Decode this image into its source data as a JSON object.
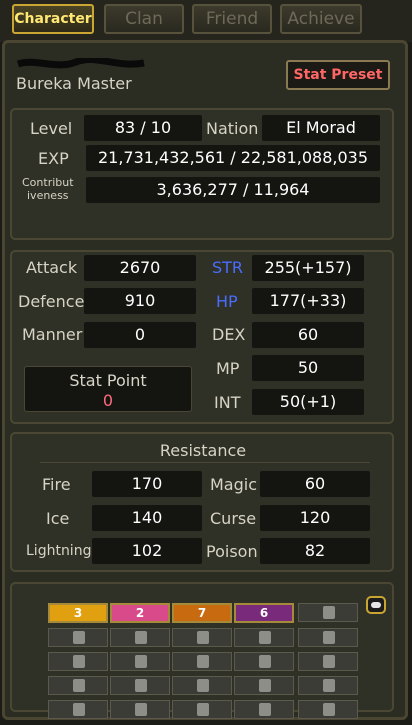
{
  "tabs": [
    {
      "label": "Character",
      "active": true
    },
    {
      "label": "Clan",
      "active": false
    },
    {
      "label": "Friend",
      "active": false
    },
    {
      "label": "Achieve",
      "active": false
    }
  ],
  "character": {
    "class_title": "Bureka Master"
  },
  "stat_preset_label": "Stat Preset",
  "info": {
    "level_label": "Level",
    "level_value": "83 / 10",
    "nation_label": "Nation",
    "nation_value": "El Morad",
    "exp_label": "EXP",
    "exp_value": "21,731,432,561 / 22,581,088,035",
    "contrib_label_1": "Contribut",
    "contrib_label_2": "iveness",
    "contrib_value": "3,636,277 / 11,964"
  },
  "stats": {
    "attack_label": "Attack",
    "attack_value": "2670",
    "defence_label": "Defence",
    "defence_value": "910",
    "manner_label": "Manner",
    "manner_value": "0",
    "str_label": "STR",
    "str_value": "255(+157)",
    "hp_label": "HP",
    "hp_value": "177(+33)",
    "dex_label": "DEX",
    "dex_value": "60",
    "mp_label": "MP",
    "mp_value": "50",
    "int_label": "INT",
    "int_value": "50(+1)",
    "stat_point_label": "Stat Point",
    "stat_point_value": "0"
  },
  "resistance": {
    "title": "Resistance",
    "fire_label": "Fire",
    "fire_value": "170",
    "magic_label": "Magic",
    "magic_value": "60",
    "ice_label": "Ice",
    "ice_value": "140",
    "curse_label": "Curse",
    "curse_value": "120",
    "lightning_label": "Lightning",
    "lightning_value": "102",
    "poison_label": "Poison",
    "poison_value": "82"
  },
  "badges": [
    {
      "text": "3",
      "color": "#e0a010"
    },
    {
      "text": "2",
      "color": "#d84a8a"
    },
    {
      "text": "7",
      "color": "#c86a10"
    },
    {
      "text": "6",
      "color": "#7a2a7a"
    }
  ],
  "colors": {
    "accent_gold": "#c9a532",
    "str_hp_blue": "#4a6cff",
    "preset_red": "#ff6666"
  }
}
